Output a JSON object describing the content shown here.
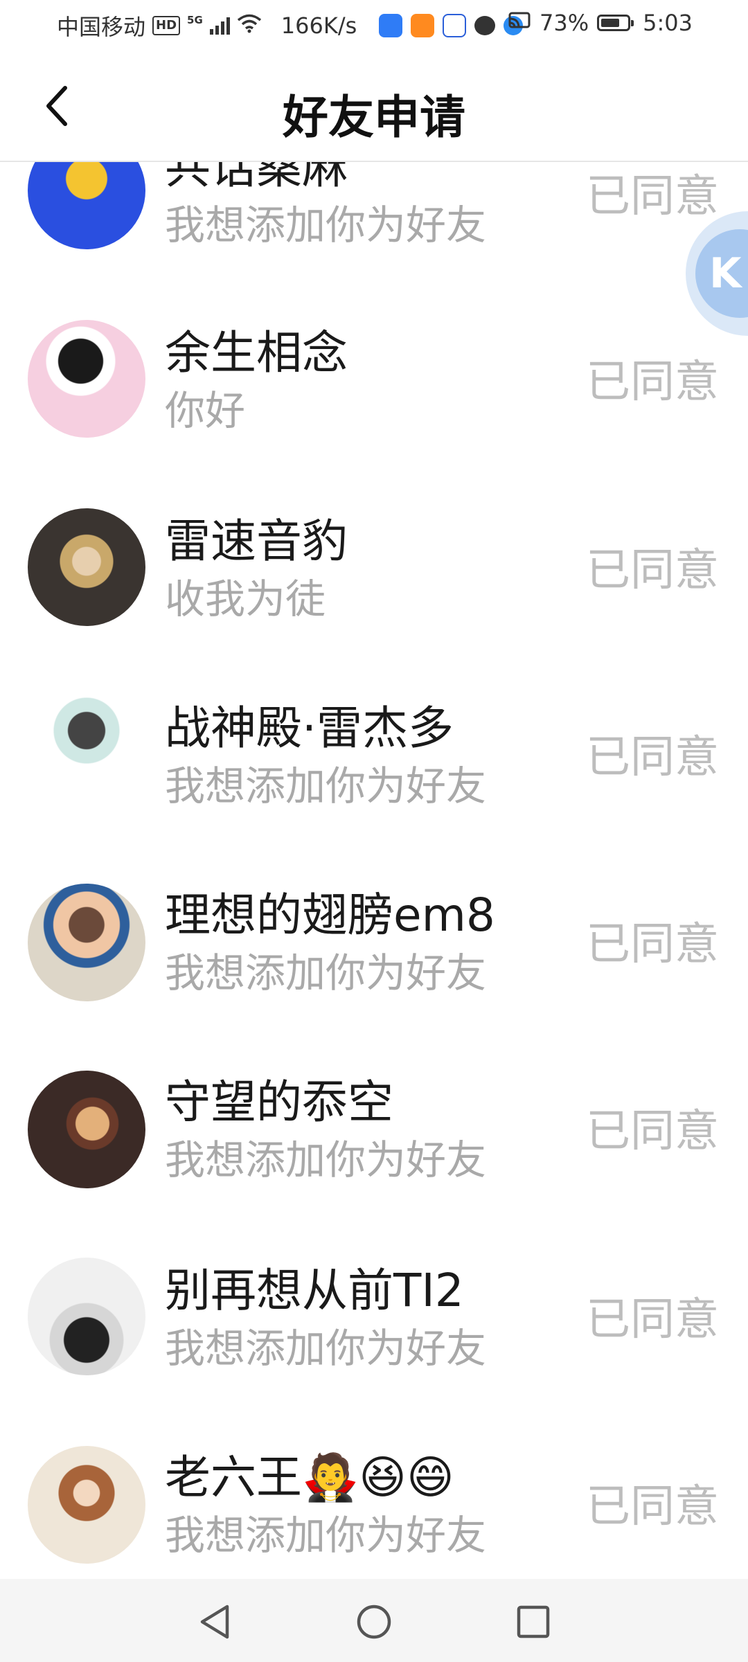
{
  "status_bar": {
    "carrier": "中国移动",
    "hd": "HD",
    "network": "5G",
    "speed": "166K/s",
    "battery_percent_text": "73%",
    "battery_level": 0.73,
    "time": "5:03",
    "app_icons": [
      "weather-icon",
      "video-app-icon",
      "baidu-icon",
      "wechat-icon",
      "browser-icon"
    ]
  },
  "header": {
    "back_icon": "chevron-left-icon",
    "title": "好友申请"
  },
  "requests": [
    {
      "name": "共话桑麻",
      "message": "我想添加你为好友",
      "status": "已同意",
      "avatar_colors": [
        "#2a4fe0",
        "#f4c430"
      ]
    },
    {
      "name": "余生相念",
      "message": "你好",
      "status": "已同意",
      "avatar_colors": [
        "#f6cfe0",
        "#1a1a1a"
      ]
    },
    {
      "name": "雷速音豹",
      "message": "收我为徒",
      "status": "已同意",
      "avatar_colors": [
        "#3a3430",
        "#c9a86a"
      ]
    },
    {
      "name": "战神殿·雷杰多",
      "message": "我想添加你为好友",
      "status": "已同意",
      "avatar_colors": [
        "#ffffff",
        "#555555"
      ]
    },
    {
      "name": "理想的翅膀em8",
      "message": "我想添加你为好友",
      "status": "已同意",
      "avatar_colors": [
        "#ddd6c8",
        "#6b4a3a"
      ]
    },
    {
      "name": "守望的忝空",
      "message": "我想添加你为好友",
      "status": "已同意",
      "avatar_colors": [
        "#3b2a26",
        "#e3b07a"
      ]
    },
    {
      "name": "别再想从前TI2",
      "message": "我想添加你为好友",
      "status": "已同意",
      "avatar_colors": [
        "#f0f0f0",
        "#222222"
      ]
    },
    {
      "name": "老六王🧛😆😄",
      "message": "我想添加你为好友",
      "status": "已同意",
      "avatar_colors": [
        "#efe6d8",
        "#a8643a"
      ]
    }
  ],
  "floating_ball": {
    "letter": "K",
    "icon": "floating-assistant-icon"
  },
  "nav_bar": {
    "icons": [
      "nav-back-icon",
      "nav-home-icon",
      "nav-recents-icon"
    ]
  },
  "colors": {
    "status_text": "#bdbdbd",
    "message_text": "#a9a9a9",
    "name_text": "#1a1a1a"
  }
}
